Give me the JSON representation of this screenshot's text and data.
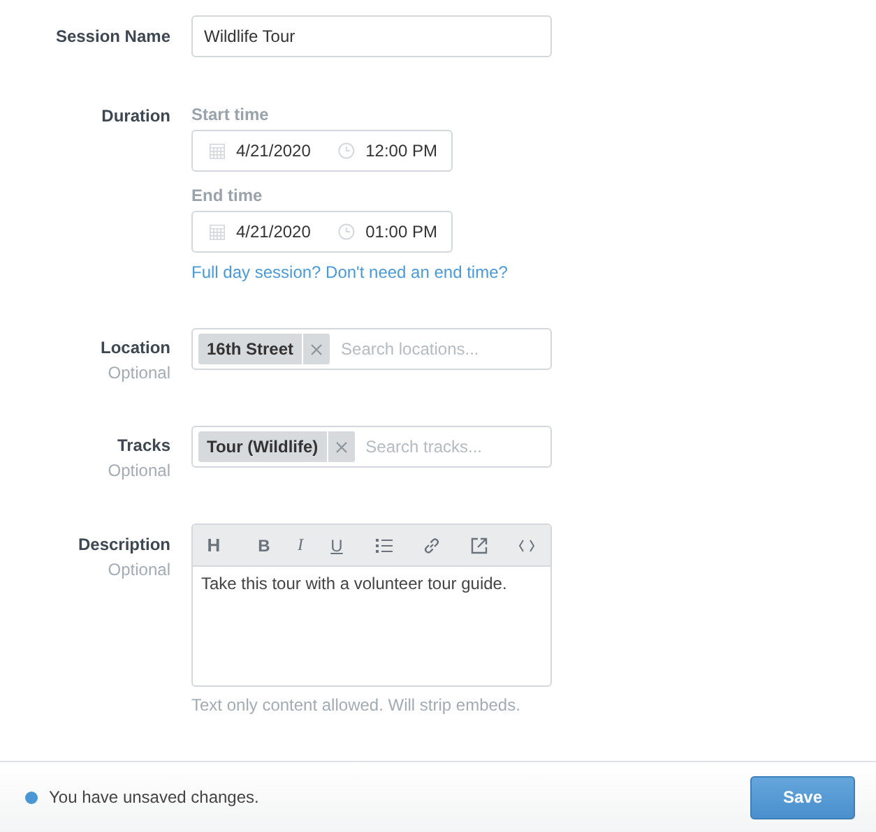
{
  "session_name": {
    "label": "Session Name",
    "value": "Wildlife Tour"
  },
  "duration": {
    "label": "Duration",
    "start": {
      "label": "Start time",
      "date": "4/21/2020",
      "time": "12:00 PM"
    },
    "end": {
      "label": "End time",
      "date": "4/21/2020",
      "time": "01:00 PM"
    },
    "link": "Full day session? Don't need an end time?"
  },
  "pickers": [
    {
      "label": "Location",
      "hint": "Optional",
      "tags": [
        "16th Street"
      ],
      "placeholder": "Search locations..."
    },
    {
      "label": "Tracks",
      "hint": "Optional",
      "tags": [
        "Tour (Wildlife)"
      ],
      "placeholder": "Search tracks..."
    }
  ],
  "description": {
    "label": "Description",
    "hint": "Optional",
    "toolbar": [
      {
        "kind": "heading",
        "glyph": "H"
      },
      {
        "kind": "bold",
        "glyph": "B"
      },
      {
        "kind": "italic",
        "glyph": "I"
      },
      {
        "kind": "underline",
        "glyph": "U"
      },
      {
        "kind": "separator"
      },
      {
        "kind": "list"
      },
      {
        "kind": "link"
      },
      {
        "kind": "embed"
      },
      {
        "kind": "code"
      }
    ],
    "value": "Take this tour with a volunteer tour guide.",
    "note": "Text only content allowed. Will strip embeds."
  },
  "footer": {
    "message": "You have unsaved changes.",
    "save": "Save"
  }
}
